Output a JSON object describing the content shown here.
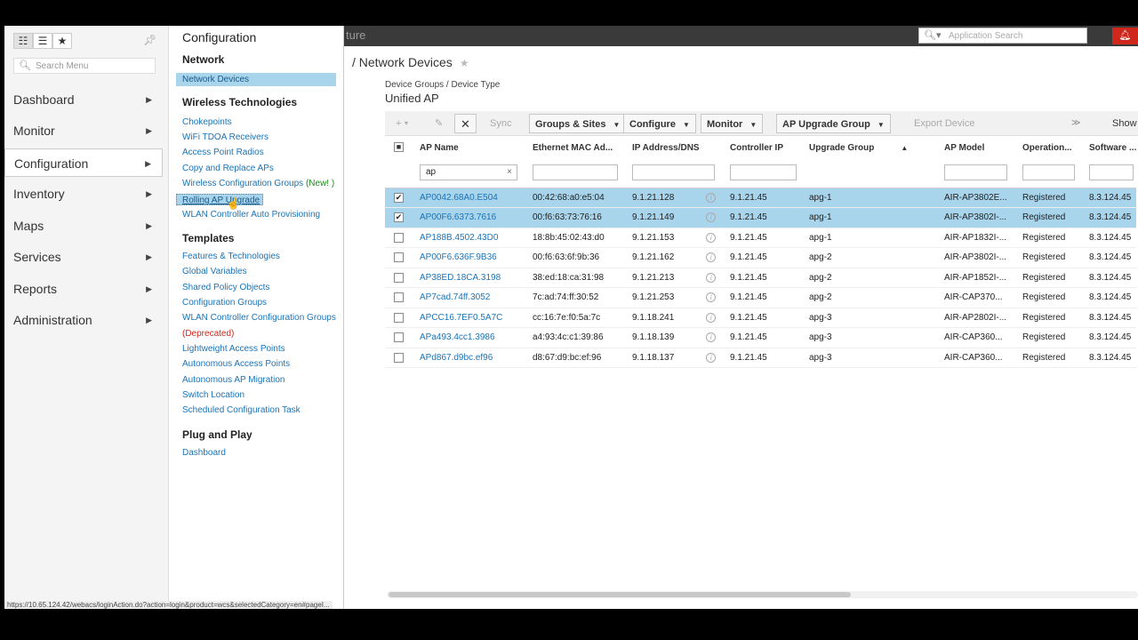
{
  "topbar": {
    "title_partial": "ture",
    "search_placeholder": "Application Search"
  },
  "leftnav": {
    "search_placeholder": "Search Menu",
    "items": [
      {
        "label": "Dashboard"
      },
      {
        "label": "Monitor"
      },
      {
        "label": "Configuration"
      },
      {
        "label": "Inventory"
      },
      {
        "label": "Maps"
      },
      {
        "label": "Services"
      },
      {
        "label": "Reports"
      },
      {
        "label": "Administration"
      }
    ]
  },
  "flyout": {
    "title": "Configuration",
    "network": {
      "heading": "Network",
      "items": [
        "Network Devices"
      ]
    },
    "wireless": {
      "heading": "Wireless Technologies",
      "items": [
        "Chokepoints",
        "WiFi TDOA Receivers",
        "Access Point Radios",
        "Copy and Replace APs",
        "Wireless Configuration Groups",
        "Rolling AP Upgrade",
        "WLAN Controller Auto Provisioning"
      ],
      "new_tag": "(New! )"
    },
    "templates": {
      "heading": "Templates",
      "items": [
        "Features & Technologies",
        "Global Variables",
        "Shared Policy Objects",
        "Configuration Groups",
        "WLAN Controller Configuration Groups",
        "Lightweight Access Points",
        "Autonomous Access Points",
        "Autonomous AP Migration",
        "Switch Location",
        "Scheduled Configuration Task"
      ],
      "deprecated_tag": "(Deprecated)"
    },
    "plugplay": {
      "heading": "Plug and Play",
      "items": [
        "Dashboard"
      ]
    }
  },
  "main": {
    "page_title": "/ Network Devices",
    "device_groups": "Device Groups / Device Type",
    "group_name": "Unified AP",
    "toolbar": {
      "add": "+",
      "edit": "✎",
      "delete": "✕",
      "sync": "Sync",
      "groups_sites": "Groups & Sites",
      "configure": "Configure",
      "monitor": "Monitor",
      "ap_upgrade_group": "AP Upgrade Group",
      "export_device": "Export Device",
      "show": "Show"
    },
    "columns": [
      "AP Name",
      "Ethernet MAC Ad...",
      "IP Address/DNS",
      "Controller IP",
      "Upgrade Group",
      "AP Model",
      "Operation...",
      "Software ..."
    ],
    "filter_ap_name": "ap",
    "rows": [
      {
        "name": "AP0042.68A0.E504",
        "mac": "00:42:68:a0:e5:04",
        "ip": "9.1.21.128",
        "ctrl": "9.1.21.45",
        "group": "apg-1",
        "model": "AIR-AP3802E...",
        "op": "Registered",
        "sw": "8.3.124.45",
        "selected": true
      },
      {
        "name": "AP00F6.6373.7616",
        "mac": "00:f6:63:73:76:16",
        "ip": "9.1.21.149",
        "ctrl": "9.1.21.45",
        "group": "apg-1",
        "model": "AIR-AP3802I-...",
        "op": "Registered",
        "sw": "8.3.124.45",
        "selected": true
      },
      {
        "name": "AP188B.4502.43D0",
        "mac": "18:8b:45:02:43:d0",
        "ip": "9.1.21.153",
        "ctrl": "9.1.21.45",
        "group": "apg-1",
        "model": "AIR-AP1832I-...",
        "op": "Registered",
        "sw": "8.3.124.45",
        "selected": false
      },
      {
        "name": "AP00F6.636F.9B36",
        "mac": "00:f6:63:6f:9b:36",
        "ip": "9.1.21.162",
        "ctrl": "9.1.21.45",
        "group": "apg-2",
        "model": "AIR-AP3802I-...",
        "op": "Registered",
        "sw": "8.3.124.45",
        "selected": false
      },
      {
        "name": "AP38ED.18CA.3198",
        "mac": "38:ed:18:ca:31:98",
        "ip": "9.1.21.213",
        "ctrl": "9.1.21.45",
        "group": "apg-2",
        "model": "AIR-AP1852I-...",
        "op": "Registered",
        "sw": "8.3.124.45",
        "selected": false
      },
      {
        "name": "AP7cad.74ff.3052",
        "mac": "7c:ad:74:ff:30:52",
        "ip": "9.1.21.253",
        "ctrl": "9.1.21.45",
        "group": "apg-2",
        "model": "AIR-CAP370...",
        "op": "Registered",
        "sw": "8.3.124.45",
        "selected": false
      },
      {
        "name": "APCC16.7EF0.5A7C",
        "mac": "cc:16:7e:f0:5a:7c",
        "ip": "9.1.18.241",
        "ctrl": "9.1.21.45",
        "group": "apg-3",
        "model": "AIR-AP2802I-...",
        "op": "Registered",
        "sw": "8.3.124.45",
        "selected": false
      },
      {
        "name": "APa493.4cc1.3986",
        "mac": "a4:93:4c:c1:39:86",
        "ip": "9.1.18.139",
        "ctrl": "9.1.21.45",
        "group": "apg-3",
        "model": "AIR-CAP360...",
        "op": "Registered",
        "sw": "8.3.124.45",
        "selected": false
      },
      {
        "name": "APd867.d9bc.ef96",
        "mac": "d8:67:d9:bc:ef:96",
        "ip": "9.1.18.137",
        "ctrl": "9.1.21.45",
        "group": "apg-3",
        "model": "AIR-CAP360...",
        "op": "Registered",
        "sw": "8.3.124.45",
        "selected": false
      }
    ]
  },
  "status_url": "https://10.65.124.42/webacs/loginAction.do?action=login&product=wcs&selectedCategory=en#pageI..."
}
